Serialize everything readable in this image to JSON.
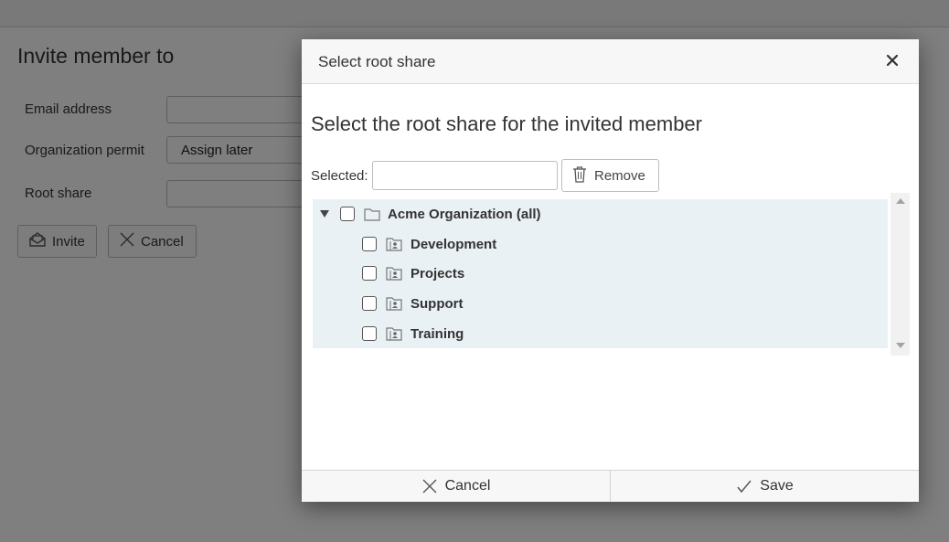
{
  "background": {
    "title": "Invite member to",
    "fields": [
      {
        "label": "Email address",
        "value": ""
      },
      {
        "label": "Organization permit",
        "value": "Assign later"
      },
      {
        "label": "Root share",
        "value": ""
      }
    ],
    "invite_label": "Invite",
    "cancel_label": "Cancel"
  },
  "modal": {
    "title": "Select root share",
    "heading": "Select the root share for the invited member",
    "selected_label": "Selected:",
    "selected_value": "",
    "remove_label": "Remove",
    "tree": {
      "root": {
        "label": "Acme Organization (all)",
        "expanded": true,
        "checked": false
      },
      "children": [
        {
          "label": "Development",
          "checked": false
        },
        {
          "label": "Projects",
          "checked": false
        },
        {
          "label": "Support",
          "checked": false
        },
        {
          "label": "Training",
          "checked": false
        }
      ]
    },
    "footer": {
      "cancel_label": "Cancel",
      "save_label": "Save"
    }
  },
  "icons": {
    "close": "close-icon",
    "trash": "trash-icon",
    "folder": "folder-icon",
    "shared_folder": "shared-folder-icon",
    "invite": "envelope-open-icon",
    "cancel": "x-icon",
    "save": "checkmark-icon"
  }
}
